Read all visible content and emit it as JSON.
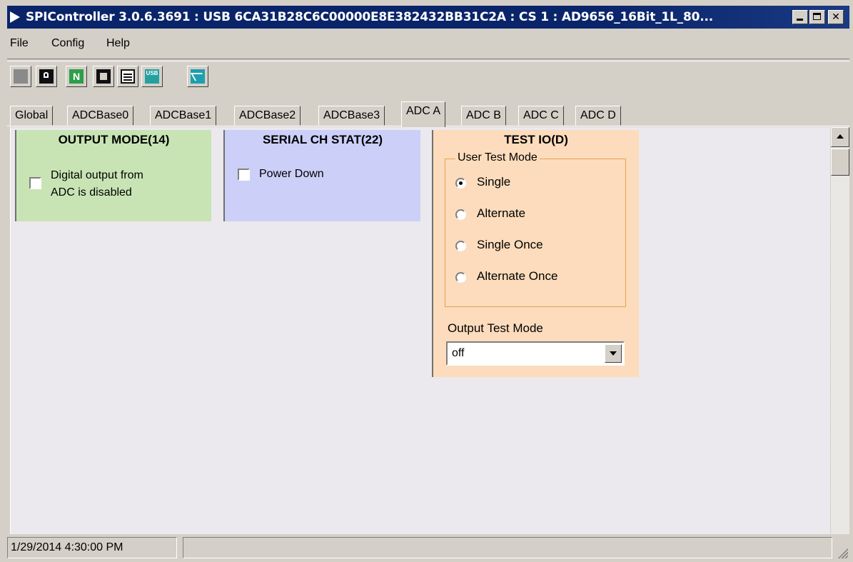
{
  "window": {
    "title": "SPIController 3.0.6.3691 : USB 6CA31B28C6C00000E8E382432BB31C2A : CS 1 : AD9656_16Bit_1L_80..."
  },
  "menu": {
    "file": "File",
    "config": "Config",
    "help": "Help"
  },
  "toolbar": {
    "icons": [
      "gray-square-icon",
      "lock-icon",
      "n-icon",
      "chip-icon",
      "register-icon",
      "usb-icon",
      "waveform-icon"
    ],
    "n_label": "N",
    "usb_label": "USB"
  },
  "tabs": [
    "Global",
    "ADCBase0",
    "ADCBase1",
    "ADCBase2",
    "ADCBase3",
    "ADC A",
    "ADC B",
    "ADC C",
    "ADC D"
  ],
  "active_tab": "ADC A",
  "panels": {
    "output_mode": {
      "title": "OUTPUT MODE(14)",
      "checkbox_label_line1": "Digital output from",
      "checkbox_label_line2": "ADC is disabled",
      "checked": false,
      "color": "#c8e4b4"
    },
    "serial_ch_stat": {
      "title": "SERIAL CH STAT(22)",
      "checkbox_label": "Power Down",
      "checked": false,
      "color": "#cccff8"
    },
    "test_io": {
      "title": "TEST IO(D)",
      "color": "#fcdcbc",
      "user_test_mode": {
        "legend": "User Test Mode",
        "options": [
          "Single",
          "Alternate",
          "Single Once",
          "Alternate Once"
        ],
        "selected": "Single"
      },
      "output_test_mode": {
        "label": "Output Test Mode",
        "value": "off"
      }
    }
  },
  "statusbar": {
    "datetime": "1/29/2014 4:30:00 PM",
    "message": ""
  }
}
